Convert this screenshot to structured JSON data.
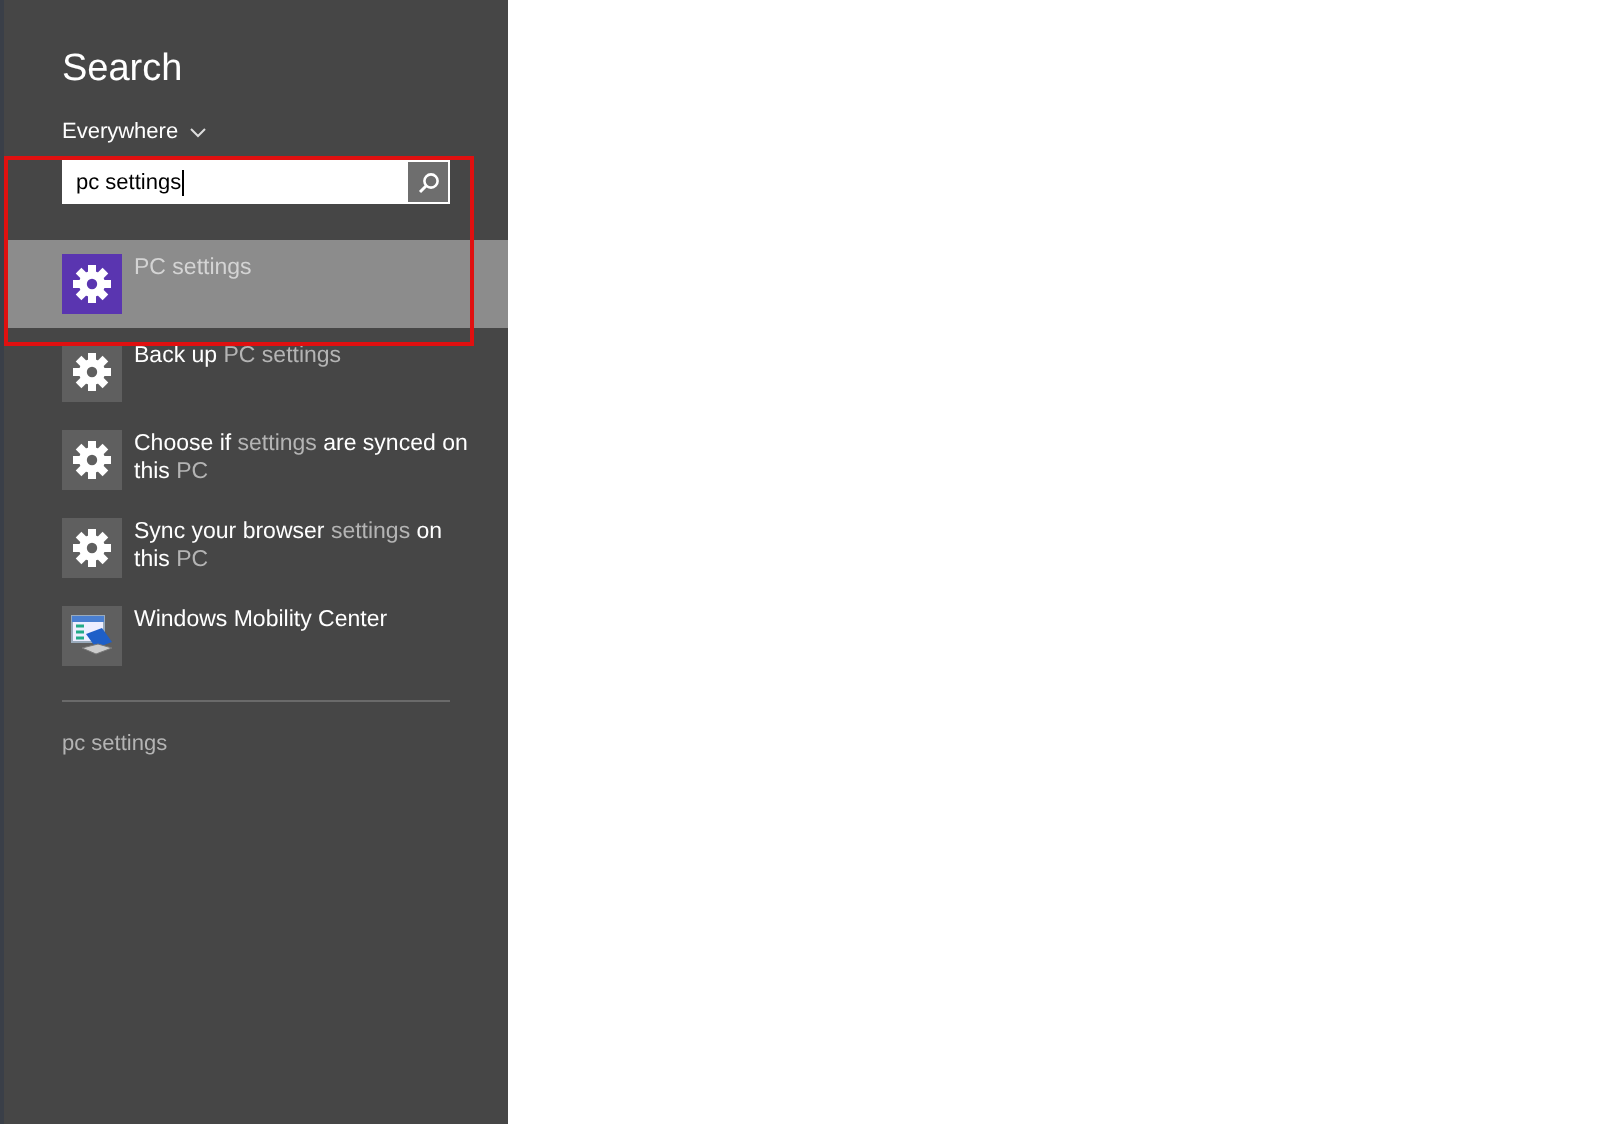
{
  "panel": {
    "title": "Search",
    "scope": "Everywhere"
  },
  "search": {
    "value": "pc settings"
  },
  "results": [
    {
      "kind": "gear",
      "selected": true,
      "label": [
        {
          "text": "PC settings",
          "match": true
        }
      ]
    },
    {
      "kind": "gear",
      "selected": false,
      "label": [
        {
          "text": "Back up ",
          "match": false
        },
        {
          "text": "PC settings",
          "match": true
        }
      ]
    },
    {
      "kind": "gear",
      "selected": false,
      "label": [
        {
          "text": "Choose if ",
          "match": false
        },
        {
          "text": "settings",
          "match": true
        },
        {
          "text": " are synced on this ",
          "match": false
        },
        {
          "text": "PC",
          "match": true
        }
      ]
    },
    {
      "kind": "gear",
      "selected": false,
      "label": [
        {
          "text": "Sync your browser ",
          "match": false
        },
        {
          "text": "settings",
          "match": true
        },
        {
          "text": " on this ",
          "match": false
        },
        {
          "text": "PC",
          "match": true
        }
      ]
    },
    {
      "kind": "mobility",
      "selected": false,
      "label": [
        {
          "text": "Windows Mobility Center",
          "match": false
        }
      ]
    }
  ],
  "suggestion": "pc settings"
}
